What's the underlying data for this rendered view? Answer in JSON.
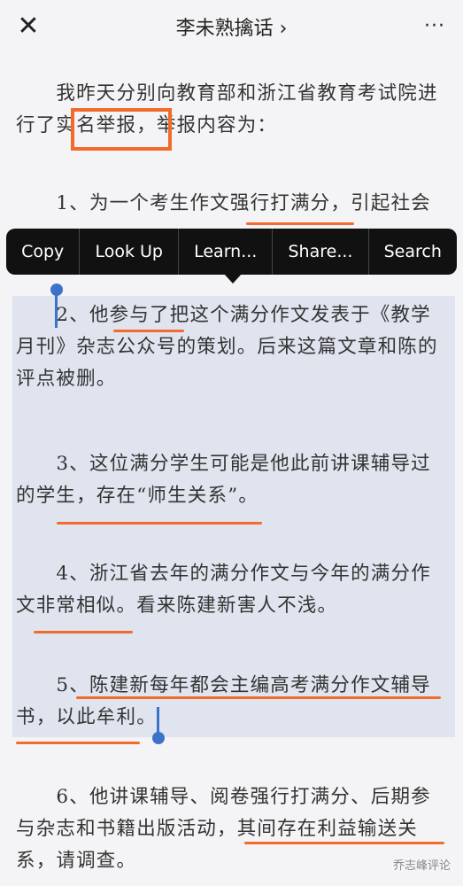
{
  "header": {
    "title": "李未熟擒话 ›",
    "close_icon": "✕",
    "more_icon": "···"
  },
  "paragraphs": {
    "p0": "　　我昨天分别向教育部和浙江省教育考试院进行了实名举报，举报内容为：",
    "p1": "　　1、为一个考生作文强行打满分，引起社会",
    "p2": "　　2、他参与了把这个满分作文发表于《教学月刊》杂志公众号的策划。后来这篇文章和陈的评点被删。",
    "p3": "　　3、这位满分学生可能是他此前讲课辅导过的学生，存在“师生关系”。",
    "p4": "　　4、浙江省去年的满分作文与今年的满分作文非常相似。看来陈建新害人不浅。",
    "p5": "　　5、陈建新每年都会主编高考满分作文辅导书，以此牟利。",
    "p6": "　　6、他讲课辅导、阅卷强行打满分、后期参与杂志和书籍出版活动，其间存在利益输送关系，请调查。"
  },
  "context_menu": {
    "items": [
      "Copy",
      "Look Up",
      "Learn...",
      "Share...",
      "Search"
    ]
  },
  "watermark": "乔志峰评论",
  "colors": {
    "highlight": "#f26b2a",
    "selection": "#dfe4ee",
    "handle": "#3a73c9",
    "menu": "#111111"
  }
}
